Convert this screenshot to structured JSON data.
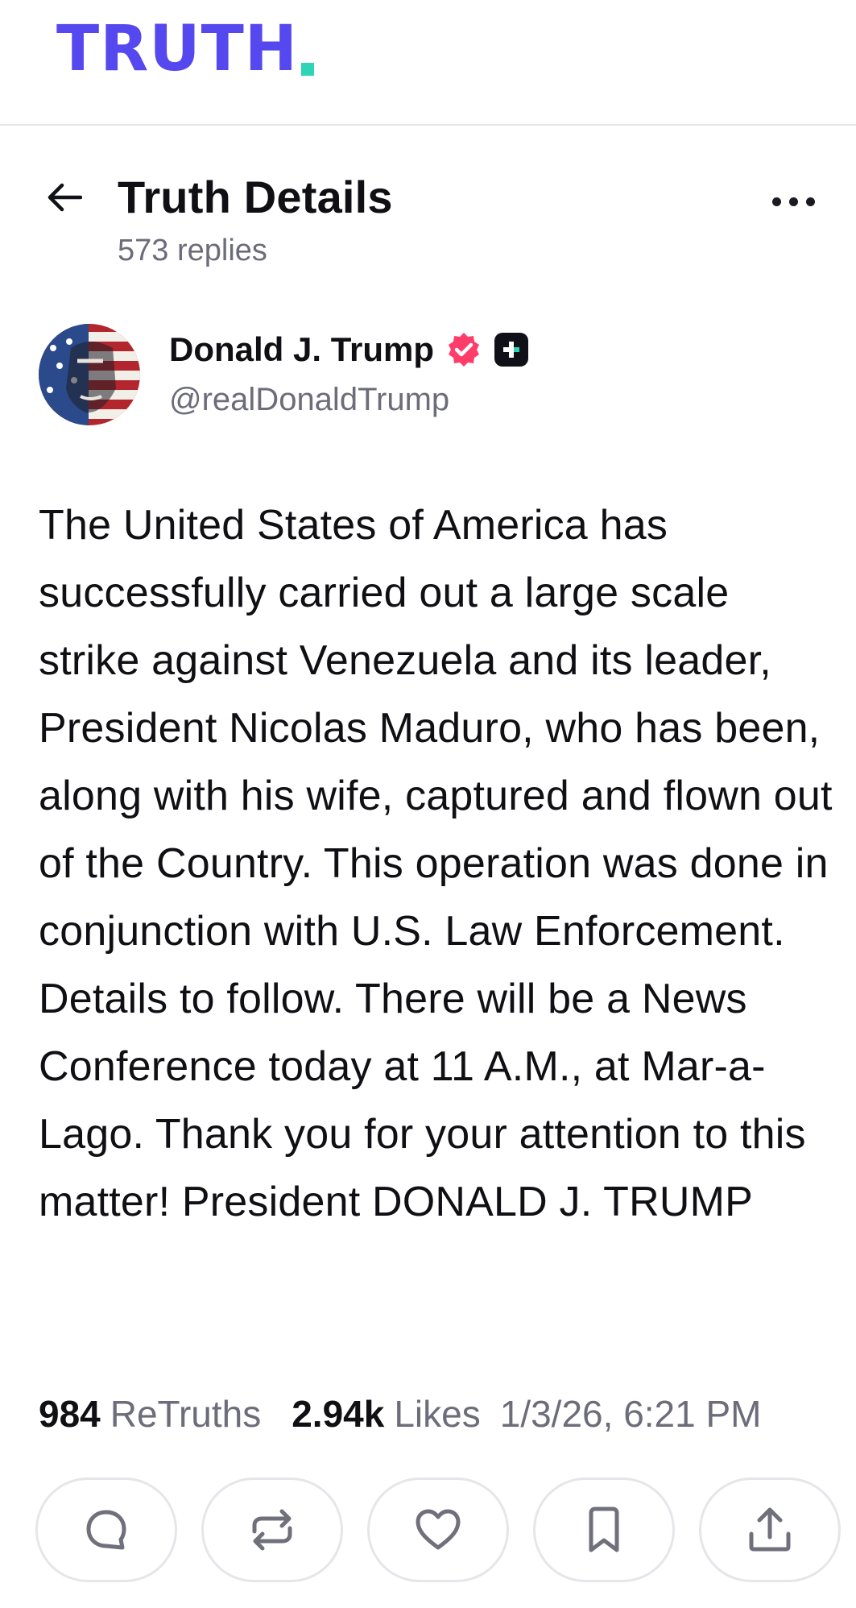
{
  "brand": {
    "logo_text": "TRUTH",
    "logo_color": "#5448ee",
    "dot_color": "#2fd3b5"
  },
  "header": {
    "title": "Truth Details",
    "replies": "573 replies",
    "back_icon": "arrow-left-icon",
    "more_icon": "more-horizontal-icon"
  },
  "author": {
    "name": "Donald J. Trump",
    "handle": "@realDonaldTrump",
    "verified_color": "#ff3d6a"
  },
  "post": {
    "text": "The United States of America has successfully carried out a large scale strike against Venezuela and its leader, President Nicolas Maduro, who has been, along with his wife, captured and flown out of the Country. This operation was done in conjunction with U.S. Law Enforcement. Details to follow. There will be a News Conference today at 11 A.M., at Mar-a-Lago. Thank you for your attention to this matter! President DONALD J. TRUMP"
  },
  "stats": {
    "retruths_count": "984",
    "retruths_label": "ReTruths",
    "likes_count": "2.94k",
    "likes_label": "Likes",
    "timestamp": "1/3/26, 6:21 PM"
  },
  "actions": [
    {
      "icon": "reply-icon"
    },
    {
      "icon": "retruth-icon"
    },
    {
      "icon": "heart-icon"
    },
    {
      "icon": "bookmark-icon"
    },
    {
      "icon": "share-icon"
    }
  ]
}
